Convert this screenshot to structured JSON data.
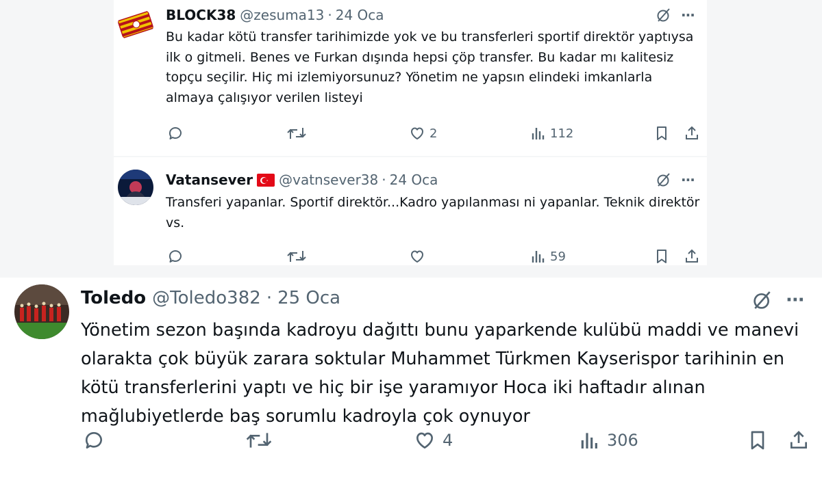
{
  "tweets": [
    {
      "name": "BLOCK38",
      "handle": "@zesuma13",
      "separator": "·",
      "date": "24 Oca",
      "text": "Bu kadar kötü transfer tarihimizde yok ve bu transferleri sportif direktör yaptıysa ilk o gitmeli. Benes ve Furkan dışında hepsi çöp transfer. Bu kadar mı kalitesiz topçu seçilir. Hiç mi izlemiyorsunuz? Yönetim ne yapsın elindeki imkanlarla almaya çalışıyor verilen listeyi",
      "likes": "2",
      "views": "112",
      "icons": [
        "reply-icon",
        "retweet-icon",
        "like-icon",
        "views-icon",
        "bookmark-icon",
        "share-icon",
        "grok-icon",
        "more-icon"
      ]
    },
    {
      "name": "Vatansever",
      "handle": "@vatnsever38",
      "separator": "·",
      "date": "24 Oca",
      "text": "Transferi yapanlar. Sportif direktör...Kadro yapılanması ni yapanlar. Teknik direktör vs.",
      "likes": "",
      "views": "59",
      "flag": "turkey-flag-icon"
    },
    {
      "name": "Toledo",
      "handle": "@Toledo382",
      "separator": "·",
      "date": "25 Oca",
      "text": "Yönetim sezon başında kadroyu dağıttı bunu yaparkende kulübü maddi ve manevi olarakta çok büyük zarara soktular Muhammet Türkmen Kayserispor tarihinin en kötü transferlerini yaptı ve hiç bir işe yaramıyor Hoca iki haftadır alınan mağlubiyetlerde baş sorumlu kadroyla çok oynuyor",
      "likes": "4",
      "views": "306"
    }
  ],
  "colors": {
    "text": "#0f1419",
    "secondary": "#536471",
    "flag_red": "#e30a17"
  },
  "more_glyph": "···"
}
